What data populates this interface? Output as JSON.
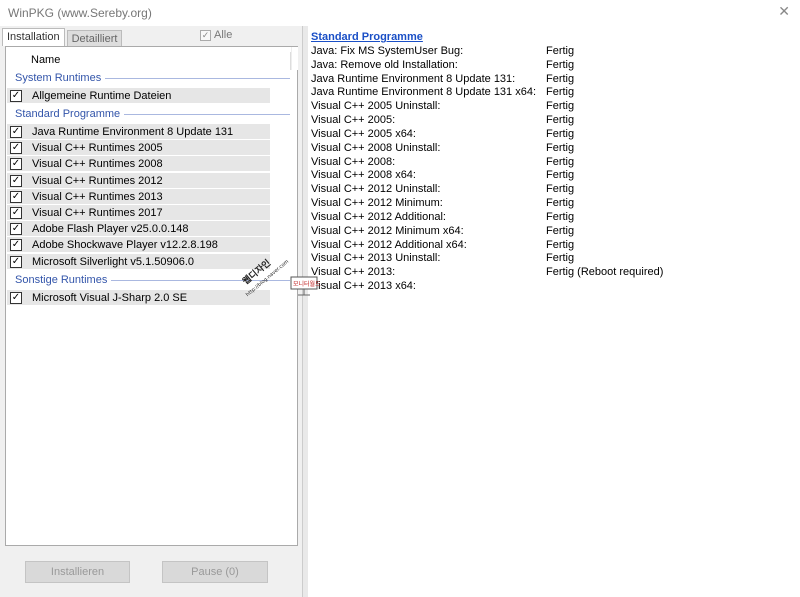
{
  "window": {
    "title": "WinPKG (www.Sereby.org)"
  },
  "tabs": [
    {
      "label": "Installation"
    },
    {
      "label": "Detailliert"
    }
  ],
  "alle_label": "Alle",
  "list": {
    "column_header": "Name"
  },
  "groups": [
    {
      "label": "System Runtimes",
      "items": [
        {
          "label": "Allgemeine Runtime Dateien",
          "checked": true
        }
      ]
    },
    {
      "label": "Standard Programme",
      "items": [
        {
          "label": "Java Runtime Environment 8 Update 131",
          "checked": true
        },
        {
          "label": "Visual C++ Runtimes 2005",
          "checked": true
        },
        {
          "label": "Visual C++ Runtimes 2008",
          "checked": true
        },
        {
          "label": "Visual C++ Runtimes 2012",
          "checked": true
        },
        {
          "label": "Visual C++ Runtimes 2013",
          "checked": true
        },
        {
          "label": "Visual C++ Runtimes 2017",
          "checked": true
        },
        {
          "label": "Adobe Flash Player v25.0.0.148",
          "checked": true
        },
        {
          "label": "Adobe Shockwave Player v12.2.8.198",
          "checked": true
        },
        {
          "label": "Microsoft Silverlight v5.1.50906.0",
          "checked": true
        }
      ]
    },
    {
      "label": "Sonstige Runtimes",
      "items": [
        {
          "label": "Microsoft Visual J-Sharp 2.0 SE",
          "checked": true
        }
      ]
    }
  ],
  "buttons": {
    "install": "Installieren",
    "pause": "Pause (0)"
  },
  "log": {
    "title": "Standard Programme",
    "rows": [
      {
        "step": "Java: Fix MS SystemUser Bug:",
        "status": "Fertig"
      },
      {
        "step": "Java: Remove old Installation:",
        "status": "Fertig"
      },
      {
        "step": "Java Runtime Environment 8 Update 131:",
        "status": "Fertig"
      },
      {
        "step": "Java Runtime Environment 8 Update 131 x64:",
        "status": "Fertig"
      },
      {
        "step": "Visual C++ 2005 Uninstall:",
        "status": "Fertig"
      },
      {
        "step": "Visual C++ 2005:",
        "status": "Fertig"
      },
      {
        "step": "Visual C++ 2005 x64:",
        "status": "Fertig"
      },
      {
        "step": "Visual C++ 2008 Uninstall:",
        "status": "Fertig"
      },
      {
        "step": "Visual C++ 2008:",
        "status": "Fertig"
      },
      {
        "step": "Visual C++ 2008 x64:",
        "status": "Fertig"
      },
      {
        "step": "Visual C++ 2012 Uninstall:",
        "status": "Fertig"
      },
      {
        "step": "Visual C++ 2012 Minimum:",
        "status": "Fertig"
      },
      {
        "step": "Visual C++ 2012 Additional:",
        "status": "Fertig"
      },
      {
        "step": "Visual C++ 2012 Minimum x64:",
        "status": "Fertig"
      },
      {
        "step": "Visual C++ 2012 Additional x64:",
        "status": "Fertig"
      },
      {
        "step": "Visual C++ 2013 Uninstall:",
        "status": "Fertig"
      },
      {
        "step": "Visual C++ 2013:",
        "status": "Fertig (Reboot required)"
      },
      {
        "step": "Visual C++ 2013 x64:",
        "status": ""
      }
    ]
  },
  "colors": {
    "group_text": "#3355aa",
    "log_title": "#1a4fc6",
    "item_bg": "#e6e6e6"
  }
}
